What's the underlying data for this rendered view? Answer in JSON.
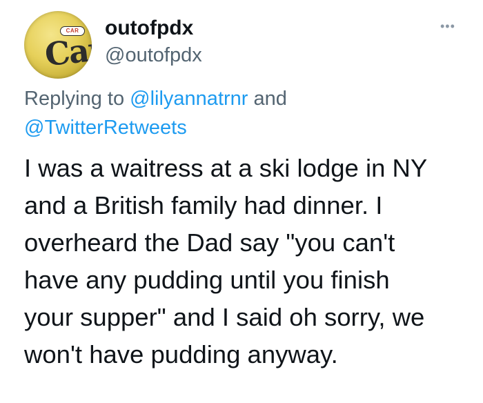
{
  "author": {
    "display_name": "outofpdx",
    "handle": "@outofpdx",
    "avatar": {
      "badge_text": "CAR",
      "mark_text": "Car"
    }
  },
  "more_icon": "more-horizontal-icon",
  "reply_context": {
    "prefix": "Replying to ",
    "mention_1": "@lilyannatrnr",
    "conjunction": " and",
    "mention_2": "@TwitterRetweets"
  },
  "tweet": {
    "lines": [
      "I was a waitress at a ski lodge in NY",
      "and a British family had dinner. I",
      "overheard the Dad say \"you can't",
      "have any pudding until you finish",
      "your supper\" and I said oh sorry, we",
      "won't have pudding anyway."
    ]
  },
  "colors": {
    "text_primary": "#0f1419",
    "text_secondary": "#536471",
    "link": "#1d9bf0",
    "avatar_yellow": "#e6d05a"
  }
}
